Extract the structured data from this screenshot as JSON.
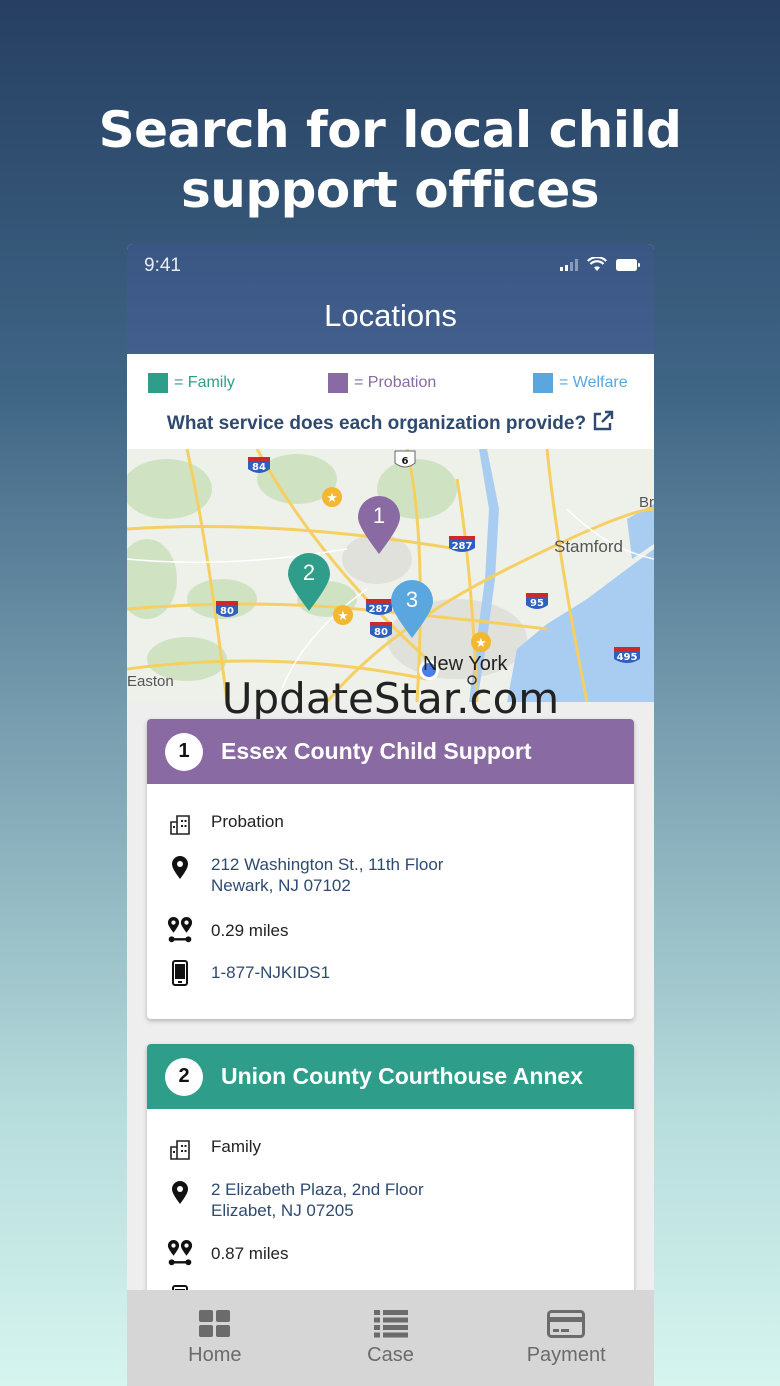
{
  "headline": {
    "line1": "Search for local child",
    "line2": "support offices"
  },
  "status": {
    "time": "9:41"
  },
  "nav": {
    "title": "Locations"
  },
  "legend": {
    "family": {
      "label": "= Family",
      "color": "#2e9e8a"
    },
    "probation": {
      "label": "= Probation",
      "color": "#8a6aa3"
    },
    "welfare": {
      "label": "= Welfare",
      "color": "#5aa6df"
    },
    "service_link": "What service does each organization provide?"
  },
  "map": {
    "labels": {
      "stamford": "Stamford",
      "new_york": "New York",
      "easton": "Easton",
      "br": "Br"
    },
    "shields": [
      "84",
      "6",
      "287",
      "287",
      "80",
      "80",
      "95",
      "495"
    ],
    "pins": [
      {
        "number": "1",
        "color": "#8a6aa3"
      },
      {
        "number": "2",
        "color": "#2e9e8a"
      },
      {
        "number": "3",
        "color": "#5aa6df"
      }
    ]
  },
  "watermark": "UpdateStar.com",
  "cards": [
    {
      "number": "1",
      "title": "Essex County Child Support",
      "header_color": "#8a6aa3",
      "type": "Probation",
      "address_line1": "212 Washington St., 11th Floor",
      "address_line2": "Newark, NJ 07102",
      "distance": "0.29 miles",
      "phone": "1-877-NJKIDS1"
    },
    {
      "number": "2",
      "title": "Union County Courthouse Annex",
      "header_color": "#2e9e8a",
      "type": "Family",
      "address_line1": "2 Elizabeth Plaza, 2nd Floor",
      "address_line2": "Elizabet, NJ 07205",
      "distance": "0.87 miles"
    }
  ],
  "tabs": [
    {
      "label": "Home",
      "icon": "grid-icon"
    },
    {
      "label": "Case",
      "icon": "list-icon"
    },
    {
      "label": "Payment",
      "icon": "credit-card-icon"
    }
  ]
}
